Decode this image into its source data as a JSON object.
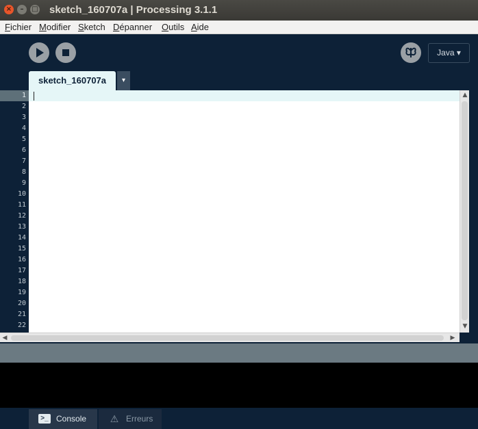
{
  "window": {
    "title": "sketch_160707a | Processing 3.1.1",
    "close_glyph": "×",
    "minimize_glyph": "–",
    "maximize_glyph": "□"
  },
  "menubar": {
    "items": [
      {
        "first": "F",
        "rest": "ichier"
      },
      {
        "first": "M",
        "rest": "odifier"
      },
      {
        "first": "S",
        "rest": "ketch"
      },
      {
        "first": "D",
        "rest": "épanner"
      },
      {
        "first": "O",
        "rest": "utils"
      },
      {
        "first": "A",
        "rest": "ide"
      }
    ]
  },
  "toolbar": {
    "run_icon": "play-icon",
    "stop_icon": "stop-icon",
    "debug_icon": "butterfly-icon",
    "mode_label": "Java ▾"
  },
  "tabs": {
    "active_label": "sketch_160707a",
    "menu_glyph": "▾"
  },
  "editor": {
    "line_numbers": [
      "1",
      "2",
      "3",
      "4",
      "5",
      "6",
      "7",
      "8",
      "9",
      "10",
      "11",
      "12",
      "13",
      "14",
      "15",
      "16",
      "17",
      "18",
      "19",
      "20",
      "21",
      "22"
    ],
    "current_line": 1,
    "content": ""
  },
  "scrollbars": {
    "up": "▲",
    "down": "▼",
    "left": "◀",
    "right": "▶"
  },
  "footer": {
    "console_label": "Console",
    "console_icon_glyph": ">_",
    "errors_label": "Erreurs",
    "errors_icon_glyph": "⚠"
  },
  "colors": {
    "background": "#0d2137",
    "editor_bg": "#ffffff",
    "current_line": "#e5f6f7",
    "console_bg": "#000000",
    "status_bar": "#6b7a82"
  }
}
